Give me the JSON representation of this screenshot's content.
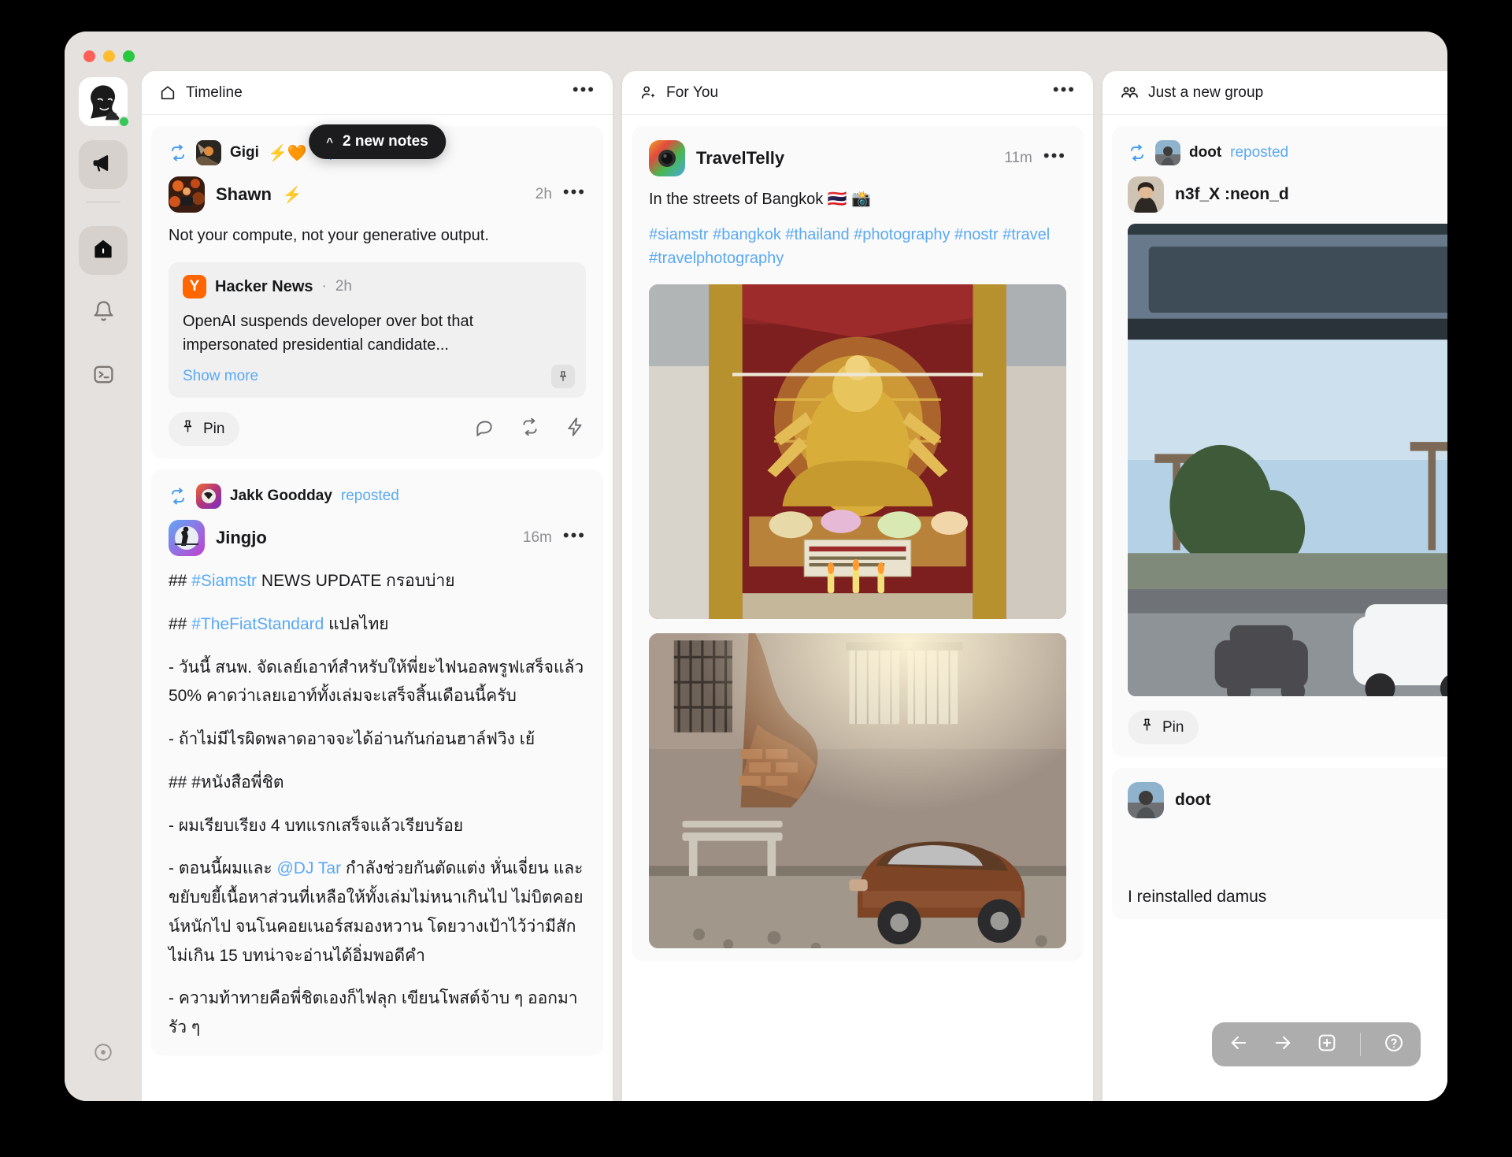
{
  "window": {
    "traffic_lights": [
      "close",
      "minimize",
      "maximize"
    ]
  },
  "sidebar": {
    "items": [
      {
        "name": "profile-avatar",
        "label": "",
        "icon": "user-avatar",
        "active": false,
        "presence": "online"
      },
      {
        "name": "broadcast",
        "label": "",
        "icon": "megaphone-icon",
        "active": true
      },
      {
        "name": "home",
        "label": "",
        "icon": "home-icon",
        "active": true
      },
      {
        "name": "notifications",
        "label": "",
        "icon": "bell-icon",
        "active": false
      },
      {
        "name": "console",
        "label": "",
        "icon": "terminal-icon",
        "active": false
      },
      {
        "name": "settings",
        "label": "",
        "icon": "target-icon",
        "active": false
      }
    ]
  },
  "columns": [
    {
      "id": "timeline",
      "title": "Timeline",
      "icon": "home-icon",
      "more_label": "•••",
      "new_notes_pill": {
        "label": "2 new notes",
        "chevron": "^"
      },
      "notes": [
        {
          "repost": {
            "name": "Gigi",
            "emoji": "⚡🧡",
            "action": "reposted"
          },
          "author": {
            "name": "Shawn",
            "emoji": "⚡"
          },
          "timestamp": "2h",
          "body": "Not your compute, not your generative output.",
          "embed": {
            "logo_letter": "Y",
            "source": "Hacker News",
            "separator": "·",
            "timestamp": "2h",
            "title": "OpenAI suspends developer over bot that impersonated presidential candidate...",
            "show_more": "Show more",
            "pin_icon": "pin-icon"
          },
          "actions": {
            "pin_label": "Pin",
            "icons": [
              "reply-icon",
              "repost-icon",
              "zap-icon"
            ]
          }
        },
        {
          "repost": {
            "name": "Jakk Goodday",
            "emoji": "",
            "action": "reposted"
          },
          "author": {
            "name": "Jingjo",
            "emoji": ""
          },
          "timestamp": "16m",
          "lines": [
            {
              "prefix": "## ",
              "tag": "#Siamstr",
              "rest": " NEWS UPDATE กรอบบ่าย"
            },
            {
              "prefix": "## ",
              "tag": "#TheFiatStandard",
              "rest": " แปลไทย"
            },
            {
              "prefix": "",
              "tag": "",
              "rest": "- วันนี้ สนพ. จัดเลย์เอาท์สำหรับให้พี่ยะไฟนอลพรูฟเสร็จแล้ว 50% คาดว่าเลยเอาท์ทั้งเล่มจะเสร็จสิ้นเดือนนี้ครับ"
            },
            {
              "prefix": "",
              "tag": "",
              "rest": "- ถ้าไม่มีไรผิดพลาดอาจจะได้อ่านกันก่อนฮาล์ฟวิง เย้"
            },
            {
              "prefix": "",
              "tag": "",
              "rest": "## #หนังสือพี่ชิต"
            },
            {
              "prefix": "",
              "tag": "",
              "rest": "- ผมเรียบเรียง 4 บทแรกเสร็จแล้วเรียบร้อย"
            },
            {
              "prefix": "",
              "tag": "@DJ Tar",
              "rest": ""
            },
            {
              "prefix": "",
              "tag": "",
              "rest": "- ความท้าทายคือพี่ชิตเองก็ไฟลุก เขียนโพสต์จ้าบ ๆ ออกมารัว ๆ"
            }
          ],
          "thai_block_1_pre": "- ตอนนี้ผมและ ",
          "thai_block_1_post": " กำลังช่วยกันตัดแต่ง หั่นเจี่ยน และขยับขยี้เนื้อหาส่วนที่เหลือให้ทั้งเล่มไม่หนาเกินไป ไม่บิตคอยน์หนักไป จนโนคอยเนอร์สมองหวาน โดยวางเป้าไว้ว่ามีสักไม่เกิน 15 บทน่าจะอ่านได้อิ่มพอดีคำ"
        }
      ]
    },
    {
      "id": "for-you",
      "title": "For You",
      "icon": "person-sparkle-icon",
      "more_label": "•••",
      "notes": [
        {
          "author": {
            "name": "TravelTelly"
          },
          "timestamp": "11m",
          "body": "In the streets of Bangkok 🇹🇭 📸",
          "hashtags": "#siamstr #bangkok #thailand #photography #nostr #travel #travelphotography",
          "media": [
            "bangkok-shrine-photo",
            "bangkok-street-car-photo"
          ]
        }
      ]
    },
    {
      "id": "just-a-new-group",
      "title": "Just a new group",
      "icon": "group-icon",
      "notes": [
        {
          "repost": {
            "name": "doot",
            "action": "reposted"
          },
          "author": {
            "name": "n3f_X :neon_d"
          },
          "media": [
            "bus-window-road-photo"
          ],
          "actions": {
            "pin_label": "Pin"
          }
        },
        {
          "author": {
            "name": "doot"
          },
          "body": "I reinstalled damus"
        }
      ]
    }
  ],
  "float_toolbar": {
    "buttons": [
      {
        "name": "back-button",
        "icon": "arrow-left-icon",
        "label": "←"
      },
      {
        "name": "forward-button",
        "icon": "arrow-right-icon",
        "label": "→"
      },
      {
        "name": "add-button",
        "icon": "plus-square-icon",
        "label": ""
      },
      {
        "name": "help-button",
        "icon": "question-circle-icon",
        "label": ""
      }
    ]
  },
  "colors": {
    "accent_blue": "#5aa9f5",
    "hn_orange": "#ff6600",
    "presence_green": "#36c75b",
    "window_bg": "#e5e1de",
    "card_bg": "#fafafa"
  }
}
